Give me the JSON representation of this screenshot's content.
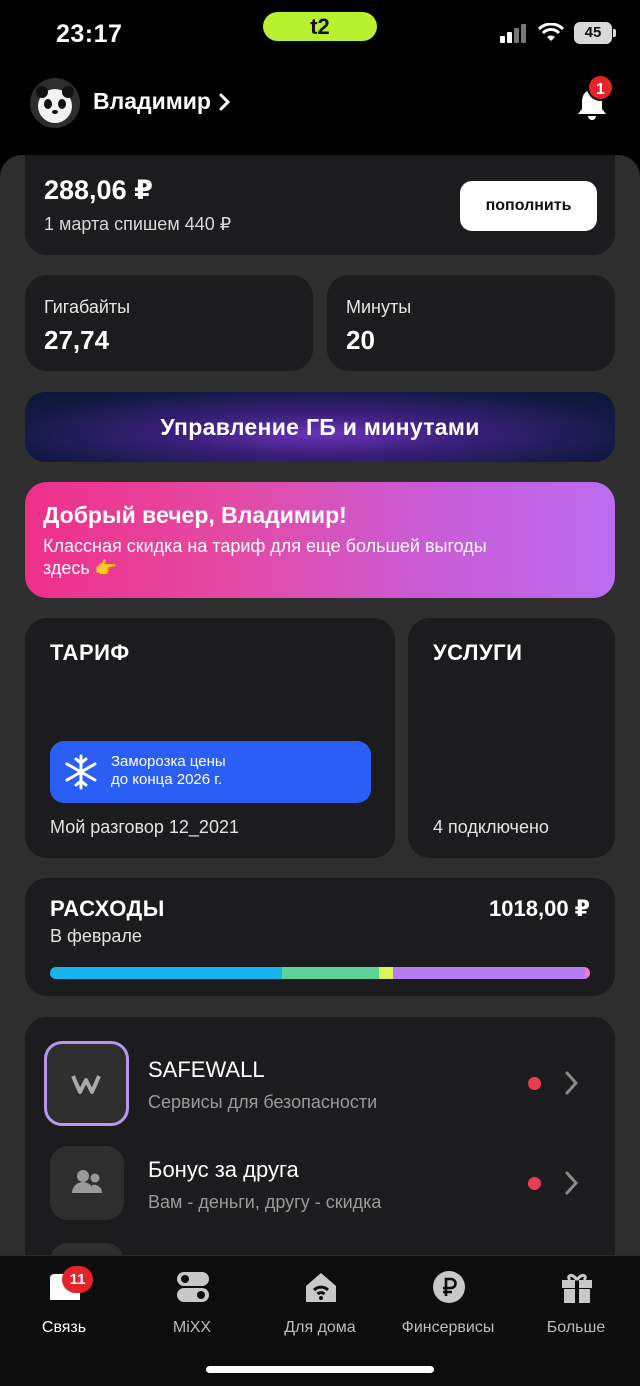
{
  "status_bar": {
    "time": "23:17",
    "carrier": "t2",
    "battery": "45"
  },
  "header": {
    "username": "Владимир",
    "notifications_count": "1"
  },
  "balance": {
    "amount": "288,06 ₽",
    "note": "1 марта спишем 440 ₽",
    "topup_label": "пополнить"
  },
  "stats": [
    {
      "label": "Гигабайты",
      "value": "27,74"
    },
    {
      "label": "Минуты",
      "value": "20"
    }
  ],
  "manage_button": "Управление ГБ и минутами",
  "promo": {
    "title": "Добрый вечер, Владимир!",
    "text": "Классная скидка на тариф для еще большей выгоды здесь 👉"
  },
  "tariff": {
    "title": "ТАРИФ",
    "freeze_line1": "Заморозка цены",
    "freeze_line2": "до конца 2026 г.",
    "name": "Мой разговор 12_2021"
  },
  "services": {
    "title": "УСЛУГИ",
    "count_text": "4 подключено"
  },
  "expenses": {
    "title": "РАСХОДЫ",
    "period": "В феврале",
    "amount": "1018,00 ₽",
    "bar_segments": [
      {
        "fraction": 0.43,
        "color": "#18b4f0"
      },
      {
        "fraction": 0.18,
        "color": "#5bd39a"
      },
      {
        "fraction": 0.026,
        "color": "#dcf35a"
      },
      {
        "fraction": 0.354,
        "color": "#b77cf2"
      },
      {
        "fraction": 0.01,
        "color": "#f07cc8"
      }
    ]
  },
  "list": [
    {
      "title": "SAFEWALL",
      "subtitle": "Сервисы для безопасности",
      "icon": "safewall-icon"
    },
    {
      "title": "Бонус за друга",
      "subtitle": "Вам - деньги, другу - скидка",
      "icon": "people-icon"
    }
  ],
  "tabs": [
    {
      "label": "Связь",
      "icon": "sim-icon",
      "badge": "11"
    },
    {
      "label": "MiXX",
      "icon": "toggles-icon"
    },
    {
      "label": "Для дома",
      "icon": "home-wifi-icon"
    },
    {
      "label": "Финсервисы",
      "icon": "ruble-icon"
    },
    {
      "label": "Больше",
      "icon": "gift-icon"
    }
  ],
  "colors": {
    "accent_lime": "#b7f12f",
    "badge_red": "#e3242b",
    "freeze_blue": "#2b5ef5"
  }
}
